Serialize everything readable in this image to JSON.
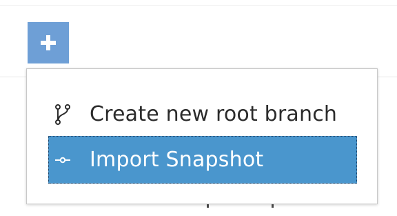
{
  "toolbar": {
    "add_button_icon": "plus-icon",
    "add_button_color": "#6e9fd6"
  },
  "menu": {
    "items": [
      {
        "label": "Create new root branch",
        "icon": "branch-icon",
        "selected": false
      },
      {
        "label": "Import Snapshot",
        "icon": "commit-icon",
        "selected": true
      }
    ],
    "selected_color": "#4a96cd"
  }
}
